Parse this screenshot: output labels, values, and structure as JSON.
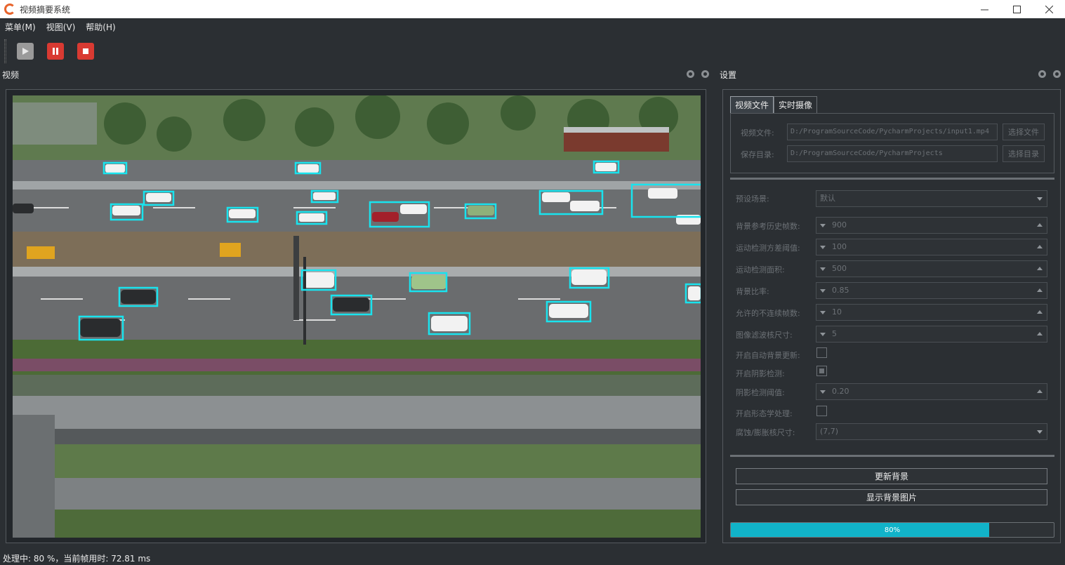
{
  "window": {
    "title": "视频摘要系统"
  },
  "menu": [
    "菜单(M)",
    "视图(V)",
    "帮助(H)"
  ],
  "video_dock": {
    "title": "视频"
  },
  "settings_dock": {
    "title": "设置"
  },
  "settings": {
    "tabs": [
      "视频文件",
      "实时摄像"
    ],
    "active_tab": 0,
    "video_file_label": "视频文件:",
    "video_file_value": "D:/ProgramSourceCode/PycharmProjects/input1.mp4",
    "select_file_button": "选择文件",
    "save_dir_label": "保存目录:",
    "save_dir_value": "D:/ProgramSourceCode/PycharmProjects",
    "select_dir_button": "选择目录",
    "preset_scene_label": "预设场景:",
    "preset_scene_value": "默认",
    "bg_history_frames_label": "背景参考历史帧数:",
    "bg_history_frames_value": "900",
    "motion_var_threshold_label": "运动检测方差阈值:",
    "motion_var_threshold_value": "100",
    "motion_area_label": "运动检测面积:",
    "motion_area_value": "500",
    "bg_ratio_label": "背景比率:",
    "bg_ratio_value": "0.85",
    "allowed_discontinuous_label": "允许的不连续帧数:",
    "allowed_discontinuous_value": "10",
    "filter_kernel_label": "图像滤波核尺寸:",
    "filter_kernel_value": "5",
    "auto_bg_update_label": "开启自动背景更新:",
    "auto_bg_update_checked": false,
    "shadow_detect_label": "开启阴影检测:",
    "shadow_detect_checked": true,
    "shadow_threshold_label": "阴影检测阈值:",
    "shadow_threshold_value": "0.20",
    "morphology_label": "开启形态学处理:",
    "morphology_checked": false,
    "erode_dilate_label": "腐蚀/膨胀核尺寸:",
    "erode_dilate_value": "(7,7)",
    "update_bg_button": "更新背景",
    "show_bg_button": "显示背景图片",
    "progress_fraction": 0.8,
    "progress_text": "80%"
  },
  "status": {
    "text": "处理中: 80 %，当前帧用时: 72.81 ms"
  },
  "colors": {
    "accent": "#11b3c9",
    "play": "#9a9a9a",
    "pause_stop": "#d93a32",
    "detection_box": "#19e3ee"
  }
}
